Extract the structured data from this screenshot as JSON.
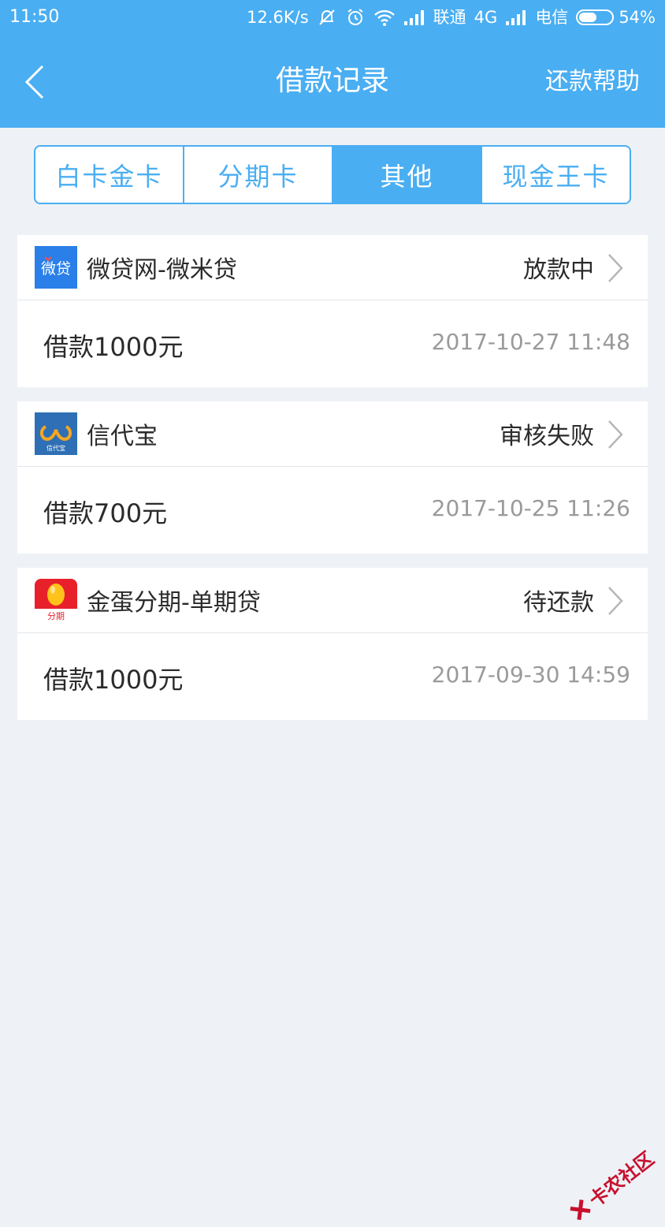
{
  "status_bar": {
    "time": "11:50",
    "network_speed": "12.6K/s",
    "carrier1": "联通",
    "network_type": "4G",
    "carrier2": "电信",
    "battery": "54%",
    "battery_level": 0.54
  },
  "header": {
    "title": "借款记录",
    "help_label": "还款帮助"
  },
  "tabs": [
    {
      "label": "白卡金卡",
      "active": false
    },
    {
      "label": "分期卡",
      "active": false
    },
    {
      "label": "其他",
      "active": true
    },
    {
      "label": "现金王卡",
      "active": false
    }
  ],
  "loans": [
    {
      "logo": "weidai-logo",
      "logo_text": "微贷",
      "lender": "微贷网-微米贷",
      "status": "放款中",
      "amount": "借款1000元",
      "date": "2017-10-27 11:48"
    },
    {
      "logo": "xindaibao-logo",
      "logo_text": "信代宝",
      "lender": "信代宝",
      "status": "审核失败",
      "amount": "借款700元",
      "date": "2017-10-25 11:26"
    },
    {
      "logo": "jindan-logo",
      "logo_text": "分期",
      "lender": "金蛋分期-单期贷",
      "status": "待还款",
      "amount": "借款1000元",
      "date": "2017-09-30 14:59"
    }
  ],
  "watermark": {
    "text": "卡农社区"
  },
  "colors": {
    "primary": "#4aaef2",
    "background": "#eef2f6",
    "date_text": "#9a9a9a",
    "watermark": "#c8102e"
  }
}
